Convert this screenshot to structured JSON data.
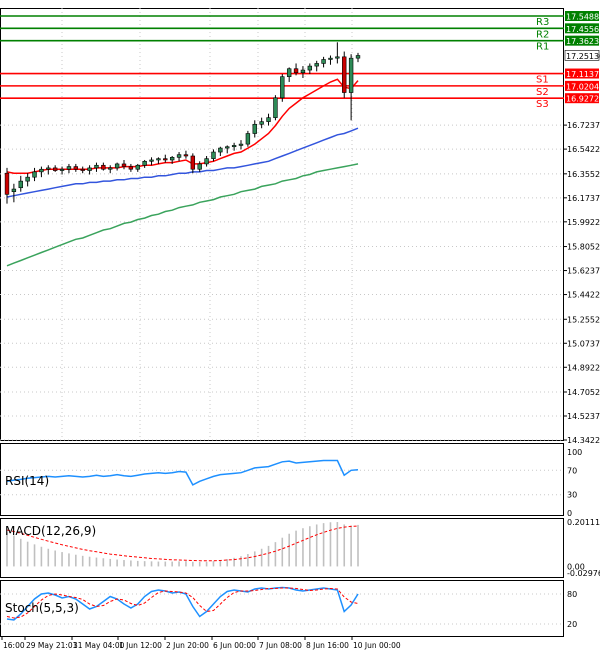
{
  "colors": {
    "background": "#ffffff",
    "border": "#000000",
    "grid_dot": "#c8c8c8",
    "bull_candle": "#2e8b57",
    "bear_candle": "#cc0000",
    "wick": "#000000",
    "resistance": "#008000",
    "support": "#ff0000",
    "ma_fast": "#ff0000",
    "ma_mid": "#3355dd",
    "ma_slow": "#3aa35c",
    "rsi_line": "#1e90ff",
    "macd_hist": "#c0c0c0",
    "macd_signal": "#ff0000",
    "stoch_main": "#1e90ff",
    "stoch_signal": "#ff0000"
  },
  "chart_data": [
    {
      "type": "candlestick",
      "price_axis_ticks": [
        "17.54880",
        "17.45560",
        "17.36230",
        "17.25130",
        "17.11370",
        "17.02040",
        "16.92720",
        "16.72370",
        "16.54220",
        "16.35520",
        "16.17370",
        "15.99220",
        "15.80520",
        "15.62370",
        "15.44220",
        "15.25520",
        "15.07370",
        "14.89220",
        "14.70520",
        "14.52370",
        "14.34220"
      ],
      "ylim": [
        14.3422,
        17.5488
      ],
      "last_price": 17.2513,
      "levels": [
        {
          "label": "R3",
          "value": 17.5488,
          "axis_label": "17.54880",
          "kind": "resistance"
        },
        {
          "label": "R2",
          "value": 17.4556,
          "axis_label": "17.45560",
          "kind": "resistance"
        },
        {
          "label": "R1",
          "value": 17.3623,
          "axis_label": "17.36230",
          "kind": "resistance"
        },
        {
          "label": "S1",
          "value": 17.1137,
          "axis_label": "17.11370",
          "kind": "support"
        },
        {
          "label": "S2",
          "value": 17.0204,
          "axis_label": "17.02040",
          "kind": "support"
        },
        {
          "label": "S3",
          "value": 16.9272,
          "axis_label": "16.92720",
          "kind": "support"
        }
      ],
      "candles": [
        {
          "o": 16.36,
          "h": 16.4,
          "l": 16.13,
          "c": 16.2
        },
        {
          "o": 16.22,
          "h": 16.28,
          "l": 16.14,
          "c": 16.24
        },
        {
          "o": 16.25,
          "h": 16.34,
          "l": 16.22,
          "c": 16.3
        },
        {
          "o": 16.3,
          "h": 16.36,
          "l": 16.26,
          "c": 16.33
        },
        {
          "o": 16.33,
          "h": 16.4,
          "l": 16.3,
          "c": 16.37
        },
        {
          "o": 16.37,
          "h": 16.41,
          "l": 16.33,
          "c": 16.39
        },
        {
          "o": 16.39,
          "h": 16.42,
          "l": 16.35,
          "c": 16.4
        },
        {
          "o": 16.4,
          "h": 16.42,
          "l": 16.37,
          "c": 16.38
        },
        {
          "o": 16.38,
          "h": 16.41,
          "l": 16.35,
          "c": 16.39
        },
        {
          "o": 16.39,
          "h": 16.43,
          "l": 16.36,
          "c": 16.41
        },
        {
          "o": 16.41,
          "h": 16.43,
          "l": 16.37,
          "c": 16.39
        },
        {
          "o": 16.39,
          "h": 16.41,
          "l": 16.36,
          "c": 16.38
        },
        {
          "o": 16.38,
          "h": 16.42,
          "l": 16.35,
          "c": 16.4
        },
        {
          "o": 16.4,
          "h": 16.44,
          "l": 16.37,
          "c": 16.42
        },
        {
          "o": 16.42,
          "h": 16.44,
          "l": 16.38,
          "c": 16.39
        },
        {
          "o": 16.39,
          "h": 16.42,
          "l": 16.36,
          "c": 16.4
        },
        {
          "o": 16.4,
          "h": 16.44,
          "l": 16.38,
          "c": 16.43
        },
        {
          "o": 16.43,
          "h": 16.46,
          "l": 16.39,
          "c": 16.41
        },
        {
          "o": 16.41,
          "h": 16.43,
          "l": 16.37,
          "c": 16.39
        },
        {
          "o": 16.39,
          "h": 16.43,
          "l": 16.37,
          "c": 16.42
        },
        {
          "o": 16.42,
          "h": 16.46,
          "l": 16.4,
          "c": 16.45
        },
        {
          "o": 16.45,
          "h": 16.48,
          "l": 16.42,
          "c": 16.46
        },
        {
          "o": 16.46,
          "h": 16.48,
          "l": 16.43,
          "c": 16.47
        },
        {
          "o": 16.47,
          "h": 16.5,
          "l": 16.44,
          "c": 16.46
        },
        {
          "o": 16.46,
          "h": 16.49,
          "l": 16.43,
          "c": 16.48
        },
        {
          "o": 16.48,
          "h": 16.52,
          "l": 16.45,
          "c": 16.5
        },
        {
          "o": 16.5,
          "h": 16.53,
          "l": 16.47,
          "c": 16.49
        },
        {
          "o": 16.49,
          "h": 16.51,
          "l": 16.36,
          "c": 16.39
        },
        {
          "o": 16.39,
          "h": 16.45,
          "l": 16.37,
          "c": 16.43
        },
        {
          "o": 16.43,
          "h": 16.49,
          "l": 16.41,
          "c": 16.47
        },
        {
          "o": 16.47,
          "h": 16.54,
          "l": 16.45,
          "c": 16.52
        },
        {
          "o": 16.52,
          "h": 16.56,
          "l": 16.49,
          "c": 16.55
        },
        {
          "o": 16.55,
          "h": 16.57,
          "l": 16.51,
          "c": 16.56
        },
        {
          "o": 16.56,
          "h": 16.59,
          "l": 16.53,
          "c": 16.57
        },
        {
          "o": 16.57,
          "h": 16.61,
          "l": 16.54,
          "c": 16.58
        },
        {
          "o": 16.58,
          "h": 16.68,
          "l": 16.56,
          "c": 16.66
        },
        {
          "o": 16.66,
          "h": 16.76,
          "l": 16.63,
          "c": 16.73
        },
        {
          "o": 16.73,
          "h": 16.78,
          "l": 16.7,
          "c": 16.75
        },
        {
          "o": 16.75,
          "h": 16.81,
          "l": 16.72,
          "c": 16.78
        },
        {
          "o": 16.78,
          "h": 16.95,
          "l": 16.76,
          "c": 16.93
        },
        {
          "o": 16.93,
          "h": 17.11,
          "l": 16.9,
          "c": 17.09
        },
        {
          "o": 17.09,
          "h": 17.16,
          "l": 17.05,
          "c": 17.15
        },
        {
          "o": 17.15,
          "h": 17.19,
          "l": 17.1,
          "c": 17.12
        },
        {
          "o": 17.12,
          "h": 17.17,
          "l": 17.08,
          "c": 17.14
        },
        {
          "o": 17.14,
          "h": 17.19,
          "l": 17.11,
          "c": 17.17
        },
        {
          "o": 17.17,
          "h": 17.21,
          "l": 17.13,
          "c": 17.19
        },
        {
          "o": 17.19,
          "h": 17.24,
          "l": 17.16,
          "c": 17.22
        },
        {
          "o": 17.22,
          "h": 17.25,
          "l": 17.18,
          "c": 17.23
        },
        {
          "o": 17.23,
          "h": 17.35,
          "l": 17.19,
          "c": 17.24
        },
        {
          "o": 17.24,
          "h": 17.28,
          "l": 16.93,
          "c": 16.97
        },
        {
          "o": 16.97,
          "h": 17.26,
          "l": 16.76,
          "c": 17.23
        },
        {
          "o": 17.23,
          "h": 17.27,
          "l": 17.2,
          "c": 17.25
        }
      ],
      "ma_fast": [
        16.37,
        16.36,
        16.36,
        16.36,
        16.37,
        16.38,
        16.39,
        16.39,
        16.39,
        16.39,
        16.39,
        16.39,
        16.39,
        16.4,
        16.4,
        16.4,
        16.4,
        16.41,
        16.41,
        16.41,
        16.42,
        16.42,
        16.43,
        16.44,
        16.44,
        16.45,
        16.46,
        16.43,
        16.43,
        16.44,
        16.45,
        16.47,
        16.49,
        16.51,
        16.52,
        16.55,
        16.58,
        16.62,
        16.66,
        16.72,
        16.79,
        16.85,
        16.89,
        16.93,
        16.96,
        16.99,
        17.02,
        17.05,
        17.07,
        17.01,
        17.0,
        17.06
      ],
      "ma_mid": [
        16.18,
        16.19,
        16.2,
        16.21,
        16.22,
        16.23,
        16.24,
        16.25,
        16.26,
        16.27,
        16.28,
        16.28,
        16.29,
        16.29,
        16.3,
        16.3,
        16.31,
        16.31,
        16.32,
        16.32,
        16.33,
        16.33,
        16.34,
        16.34,
        16.35,
        16.36,
        16.36,
        16.37,
        16.37,
        16.38,
        16.38,
        16.39,
        16.4,
        16.4,
        16.41,
        16.42,
        16.43,
        16.44,
        16.45,
        16.47,
        16.49,
        16.51,
        16.53,
        16.55,
        16.57,
        16.59,
        16.61,
        16.63,
        16.65,
        16.66,
        16.68,
        16.7
      ],
      "ma_slow": [
        15.66,
        15.68,
        15.7,
        15.72,
        15.74,
        15.76,
        15.78,
        15.8,
        15.82,
        15.84,
        15.86,
        15.87,
        15.89,
        15.91,
        15.93,
        15.94,
        15.96,
        15.98,
        15.99,
        16.01,
        16.02,
        16.04,
        16.05,
        16.07,
        16.08,
        16.1,
        16.11,
        16.12,
        16.14,
        16.15,
        16.16,
        16.18,
        16.19,
        16.2,
        16.22,
        16.23,
        16.24,
        16.26,
        16.27,
        16.28,
        16.3,
        16.31,
        16.32,
        16.34,
        16.35,
        16.37,
        16.38,
        16.39,
        16.4,
        16.41,
        16.42,
        16.43
      ],
      "x_tick_labels": [
        "16:00",
        "29 May 21:01",
        "31 May 04:00",
        "1 Jun 12:00",
        "2 Jun 20:00",
        "6 Jun 00:00",
        "7 Jun 08:00",
        "8 Jun 16:00",
        "10 Jun 00:00"
      ],
      "grid": true
    },
    {
      "type": "line",
      "name": "RSI(14)",
      "ylim": [
        0,
        100
      ],
      "axis_ticks": [
        "100",
        "70",
        "30",
        "0"
      ],
      "values": [
        52,
        54,
        55,
        57,
        58,
        59,
        60,
        59,
        60,
        61,
        60,
        59,
        60,
        62,
        60,
        61,
        63,
        61,
        60,
        62,
        64,
        65,
        66,
        65,
        66,
        68,
        67,
        46,
        52,
        56,
        60,
        63,
        64,
        65,
        66,
        70,
        74,
        75,
        76,
        80,
        84,
        85,
        82,
        83,
        84,
        85,
        86,
        86,
        86,
        62,
        70,
        71
      ]
    },
    {
      "type": "bar",
      "name": "MACD(12,26,9)",
      "ylim": [
        -0.029763,
        0.201119
      ],
      "axis_ticks": [
        "0.201119",
        "0.00",
        "-0.029763"
      ],
      "histogram": [
        0.155,
        0.14,
        0.125,
        0.112,
        0.1,
        0.089,
        0.08,
        0.072,
        0.065,
        0.059,
        0.053,
        0.048,
        0.044,
        0.04,
        0.037,
        0.034,
        0.031,
        0.029,
        0.027,
        0.025,
        0.024,
        0.023,
        0.022,
        0.022,
        0.022,
        0.023,
        0.024,
        0.021,
        0.02,
        0.021,
        0.024,
        0.028,
        0.033,
        0.039,
        0.046,
        0.056,
        0.068,
        0.08,
        0.093,
        0.11,
        0.13,
        0.148,
        0.162,
        0.173,
        0.182,
        0.19,
        0.196,
        0.2,
        0.201,
        0.19,
        0.185,
        0.188
      ],
      "signal": [
        0.165,
        0.158,
        0.15,
        0.141,
        0.132,
        0.123,
        0.114,
        0.106,
        0.098,
        0.091,
        0.084,
        0.077,
        0.071,
        0.066,
        0.061,
        0.056,
        0.052,
        0.048,
        0.045,
        0.042,
        0.039,
        0.036,
        0.034,
        0.032,
        0.03,
        0.029,
        0.028,
        0.027,
        0.026,
        0.026,
        0.026,
        0.027,
        0.029,
        0.031,
        0.035,
        0.039,
        0.045,
        0.052,
        0.06,
        0.069,
        0.08,
        0.092,
        0.105,
        0.118,
        0.131,
        0.143,
        0.154,
        0.164,
        0.172,
        0.178,
        0.181,
        0.183
      ]
    },
    {
      "type": "line",
      "name": "Stoch(5,5,3)",
      "ylim": [
        0,
        100
      ],
      "axis_ticks": [
        "80",
        "20"
      ],
      "main": [
        30,
        28,
        40,
        55,
        70,
        80,
        82,
        78,
        72,
        75,
        70,
        60,
        50,
        55,
        65,
        75,
        70,
        60,
        52,
        60,
        75,
        85,
        88,
        86,
        82,
        84,
        80,
        55,
        35,
        45,
        60,
        75,
        85,
        88,
        86,
        84,
        90,
        92,
        90,
        92,
        93,
        92,
        88,
        86,
        88,
        90,
        92,
        90,
        88,
        45,
        58,
        80
      ],
      "signal": [
        35,
        32,
        34,
        42,
        55,
        68,
        77,
        80,
        78,
        75,
        73,
        69,
        60,
        55,
        57,
        65,
        70,
        68,
        61,
        57,
        62,
        73,
        83,
        86,
        85,
        84,
        82,
        73,
        57,
        45,
        47,
        60,
        73,
        83,
        86,
        86,
        87,
        89,
        91,
        91,
        92,
        92,
        91,
        89,
        87,
        88,
        90,
        91,
        90,
        74,
        64,
        61
      ]
    }
  ]
}
